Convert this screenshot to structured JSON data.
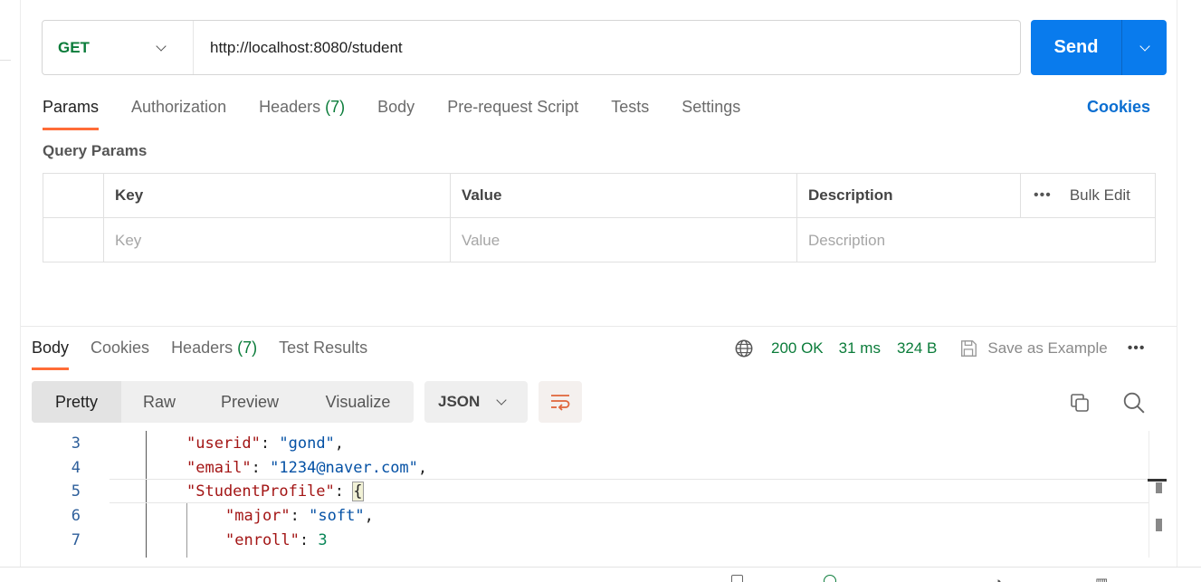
{
  "request": {
    "method": "GET",
    "url": "http://localhost:8080/student",
    "send_label": "Send"
  },
  "request_tabs": [
    {
      "label": "Params",
      "count": ""
    },
    {
      "label": "Authorization",
      "count": ""
    },
    {
      "label": "Headers",
      "count": "(7)"
    },
    {
      "label": "Body",
      "count": ""
    },
    {
      "label": "Pre-request Script",
      "count": ""
    },
    {
      "label": "Tests",
      "count": ""
    },
    {
      "label": "Settings",
      "count": ""
    }
  ],
  "cookies_link": "Cookies",
  "query_params": {
    "title": "Query Params",
    "headers": {
      "key": "Key",
      "value": "Value",
      "description": "Description",
      "bulk_edit": "Bulk Edit"
    },
    "placeholder_row": {
      "key": "Key",
      "value": "Value",
      "description": "Description"
    }
  },
  "response_tabs": [
    {
      "label": "Body",
      "count": ""
    },
    {
      "label": "Cookies",
      "count": ""
    },
    {
      "label": "Headers",
      "count": "(7)"
    },
    {
      "label": "Test Results",
      "count": ""
    }
  ],
  "response_meta": {
    "status": "200 OK",
    "time": "31 ms",
    "size": "324 B",
    "save_example": "Save as Example"
  },
  "view_modes": [
    "Pretty",
    "Raw",
    "Preview",
    "Visualize"
  ],
  "active_view_mode": "Pretty",
  "format": "JSON",
  "code_lines": [
    {
      "num": "3",
      "key": "\"userid\"",
      "value": "\"gond\"",
      "tail": ","
    },
    {
      "num": "4",
      "key": "\"email\"",
      "value": "\"1234@naver.com\"",
      "tail": ","
    },
    {
      "num": "5",
      "key": "\"StudentProfile\"",
      "value": "{",
      "tail": ""
    },
    {
      "num": "6",
      "key": "\"major\"",
      "value": "\"soft\"",
      "tail": ","
    },
    {
      "num": "7",
      "key": "\"enroll\"",
      "value": "3",
      "tail": ""
    }
  ],
  "colors": {
    "accent": "#ff6c37",
    "send": "#097bed",
    "status_green": "#0b7c3a",
    "link_blue": "#0a6ed1"
  },
  "icons": [
    "globe-icon",
    "save-icon",
    "copy-icon",
    "search-icon",
    "wrap-lines-icon",
    "more-icon",
    "chevron-down-icon"
  ]
}
